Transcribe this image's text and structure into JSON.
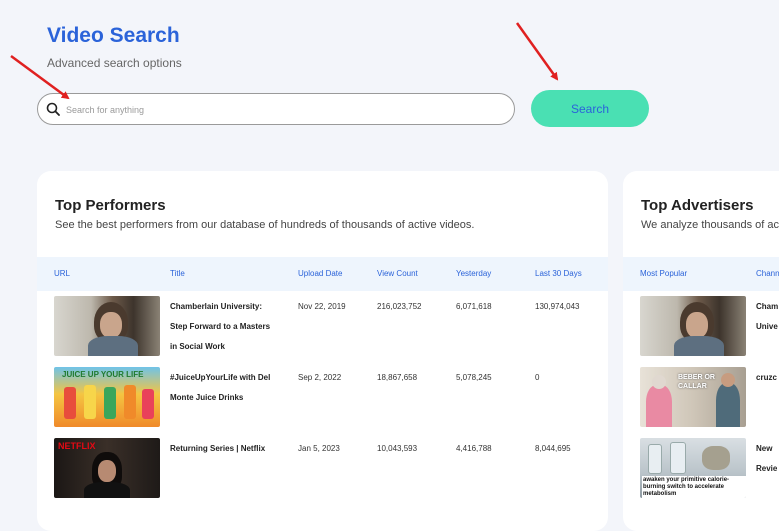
{
  "header": {
    "title": "Video Search",
    "subtitle": "Advanced search options"
  },
  "search": {
    "placeholder": "Search for anything",
    "value": "",
    "button_label": "Search"
  },
  "top_performers": {
    "title": "Top Performers",
    "description": "See the best performers from our database of hundreds of thousands of active videos.",
    "columns": [
      "URL",
      "Title",
      "Upload Date",
      "View Count",
      "Yesterday",
      "Last 30 Days"
    ],
    "rows": [
      {
        "title_lines": [
          "Chamberlain University:",
          "Step Forward to a Masters",
          "in Social Work"
        ],
        "upload_date": "Nov 22, 2019",
        "view_count": "216,023,752",
        "yesterday": "6,071,618",
        "last_30_days": "130,974,043"
      },
      {
        "title_lines": [
          "#JuiceUpYourLife with Del",
          "Monte Juice Drinks"
        ],
        "upload_date": "Sep 2, 2022",
        "view_count": "18,867,658",
        "yesterday": "5,078,245",
        "last_30_days": "0",
        "thumb_text": "JUICE UP YOUR LIFE"
      },
      {
        "title_lines": [
          "Returning Series | Netflix"
        ],
        "upload_date": "Jan 5, 2023",
        "view_count": "10,043,593",
        "yesterday": "4,416,788",
        "last_30_days": "8,044,695",
        "thumb_text": "NETFLIX"
      }
    ]
  },
  "top_advertisers": {
    "title": "Top Advertisers",
    "description": "We analyze thousands of ac",
    "columns": [
      "Most Popular",
      "Chann"
    ],
    "rows": [
      {
        "channel_lines": [
          "Cham",
          "Unive"
        ]
      },
      {
        "channel_lines": [
          "cruzc"
        ],
        "thumb_text": "BEBER OR CALLAR"
      },
      {
        "channel_lines": [
          "New",
          "Revie"
        ],
        "thumb_text": "awaken your primitive calorie-burning switch to accelerate metabolism"
      }
    ]
  },
  "colors": {
    "accent": "#2b63d9",
    "button": "#4ae0b3",
    "arrow": "#e02020",
    "header_row": "#eef5fd"
  }
}
